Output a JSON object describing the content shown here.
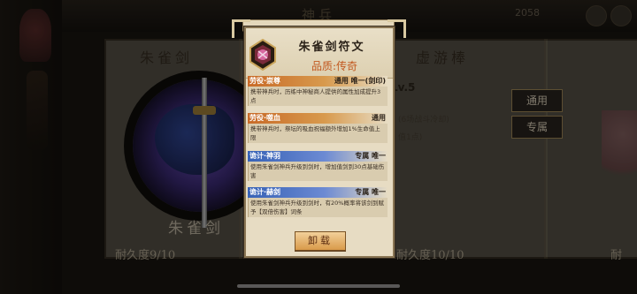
{
  "background": {
    "title": "神兵",
    "top_right_text": "2058",
    "left_card": {
      "title": "朱雀剑",
      "name": "朱雀剑",
      "durability": "耐久度9/10"
    },
    "right_card": {
      "title": "虚游棒",
      "level": "Lv.5",
      "durability": "耐久度10/10",
      "effect_1": "(6场战斗冷却)",
      "effect_2": "值1点)",
      "btn_1": "通用",
      "btn_2": "专属"
    },
    "far_card": {
      "durability": "耐"
    }
  },
  "popup": {
    "title": "朱雀剑符文",
    "quality": "品质:传奇",
    "sections": [
      {
        "name": "劳役·崇尊",
        "tag": "通用  唯一(剑印)",
        "color": "orange",
        "desc": "携带神兵时，历练中神秘商人提供的属性加成提升3点"
      },
      {
        "name": "劳役·噬血",
        "tag": "通用",
        "color": "orange",
        "desc": "携带神兵时，祭坛的吸血祝福额外增加1%生命值上限"
      },
      {
        "name": "诡计·神羽",
        "tag": "专属  唯一",
        "color": "blue",
        "desc": "使用朱雀剑神兵升级到剑时，增加值剑到30点基础伤害"
      },
      {
        "name": "诡计·赫剑",
        "tag": "专属  唯一",
        "color": "blue",
        "desc": "使用朱雀剑神兵升级到剑时，有20%概率将该剑到赋予【双倍伤害】词条"
      }
    ],
    "unload_label": "卸载"
  },
  "colors": {
    "accent": "#c2581f",
    "orange_band": "#c86a27",
    "blue_band": "#3762b6"
  }
}
